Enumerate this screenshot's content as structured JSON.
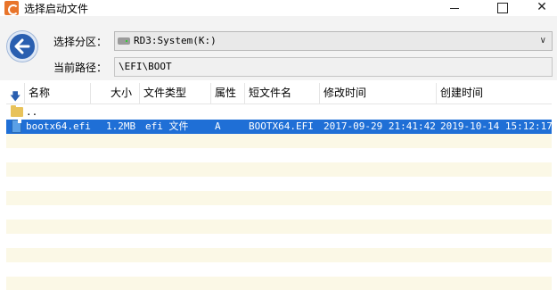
{
  "window": {
    "title": "选择启动文件",
    "minimize_symbol": "",
    "maximize_symbol": "",
    "close_symbol": "✕"
  },
  "toolbar": {
    "partition_label": "选择分区：",
    "partition_value": "RD3:System(K:)",
    "path_label": "当前路径：",
    "path_value": "\\EFI\\BOOT"
  },
  "list": {
    "columns": [
      "名称",
      "大小",
      "文件类型",
      "属性",
      "短文件名",
      "修改时间",
      "创建时间"
    ],
    "rows": [
      {
        "name": "..",
        "size": "",
        "type": "",
        "attr": "",
        "short_name": "",
        "modified": "",
        "created": "",
        "kind": "folder"
      },
      {
        "name": "bootx64.efi",
        "size": "1.2MB",
        "type": "efi 文件",
        "attr": "A",
        "short_name": "BOOTX64.EFI",
        "modified": "2017-09-29 21:41:42",
        "created": "2019-10-14 15:12:17",
        "kind": "file"
      }
    ]
  },
  "colors": {
    "selection": "#1f6fd6",
    "stripe": "#fbf8e6",
    "accent": "#2a5fb0"
  }
}
